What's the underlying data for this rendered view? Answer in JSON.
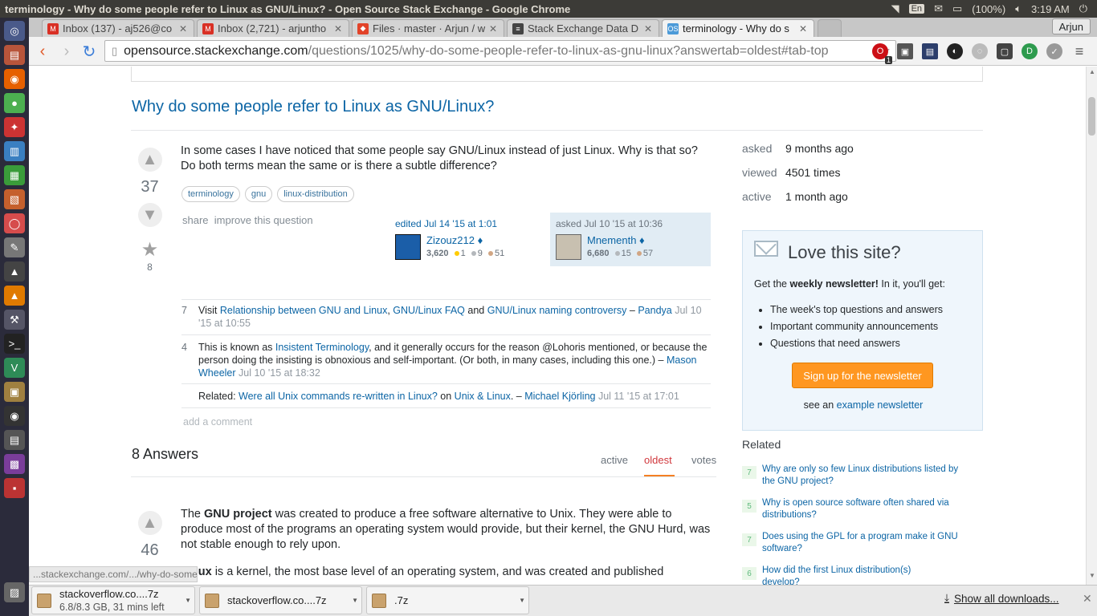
{
  "os": {
    "window_title": "terminology - Why do some people refer to Linux as GNU/Linux? - Open Source Stack Exchange - Google Chrome",
    "keyboard": "En",
    "battery": "(100%)",
    "clock": "3:19 AM"
  },
  "browser": {
    "tabs": [
      {
        "label": "Inbox (137) - aj526@co",
        "icon_color": "#d93025"
      },
      {
        "label": "Inbox (2,721) - arjuntho",
        "icon_color": "#d93025"
      },
      {
        "label": "Files · master · Arjun / w",
        "icon_color": "#e24329"
      },
      {
        "label": "Stack Exchange Data D",
        "icon_color": "#444444"
      },
      {
        "label": "terminology - Why do s",
        "icon_color": "#4c9ad8"
      }
    ],
    "user": "Arjun",
    "url_host": "opensource.stackexchange.com",
    "url_path": "/questions/1025/why-do-some-people-refer-to-linux-as-gnu-linux?answertab=oldest#tab-top",
    "opera_badge": "1"
  },
  "question": {
    "title": "Why do some people refer to Linux as GNU/Linux?",
    "votes": "37",
    "favorites": "8",
    "body": "In some cases I have noticed that some people say GNU/Linux instead of just Linux. Why is that so? Do both terms mean the same or is there a subtle difference?",
    "tags": [
      "terminology",
      "gnu",
      "linux-distribution"
    ],
    "share": "share",
    "improve": "improve this question",
    "edited": {
      "label": "edited Jul 14 '15 at 1:01",
      "user": "Zizouz212",
      "diamond": "♦",
      "rep": "3,620",
      "gold": "1",
      "silver": "9",
      "bronze": "51"
    },
    "asked": {
      "label": "asked Jul 10 '15 at 10:36",
      "user": "Mnementh",
      "diamond": "♦",
      "rep": "6,680",
      "silver": "15",
      "bronze": "57"
    },
    "comments": [
      {
        "score": "7",
        "pre": "Visit ",
        "link1": "Relationship between GNU and Linux",
        "sep1": ", ",
        "link2": "GNU/Linux FAQ",
        "sep2": " and ",
        "link3": "GNU/Linux naming controversy",
        "dash": " – ",
        "user": "Pandya",
        "time": "Jul 10 '15 at 10:55"
      },
      {
        "score": "4",
        "pre": "This is known as ",
        "link1": "Insistent Terminology",
        "text": ", and it generally occurs for the reason @Lohoris mentioned, or because the person doing the insisting is obnoxious and self-important. (Or both, in many cases, including this one.) – ",
        "user": "Mason Wheeler",
        "time": "Jul 10 '15 at 18:32"
      },
      {
        "score": "",
        "pre": "Related: ",
        "link1": "Were all Unix commands re-written in Linux?",
        "on": " on ",
        "link2": "Unix & Linux",
        "dash": ". – ",
        "user": "Michael Kjörling",
        "time": "Jul 11 '15 at 17:01"
      }
    ],
    "add_comment": "add a comment"
  },
  "answers": {
    "header": "8 Answers",
    "tabs": [
      "active",
      "oldest",
      "votes"
    ],
    "first": {
      "votes": "46",
      "p1_pre": "The ",
      "p1_bold": "GNU project",
      "p1_rest": " was created to produce a free software alternative to Unix. They were able to produce most of the programs an operating system would provide, but their kernel, the GNU Hurd, was not stable enough to rely upon.",
      "p2_bold": "Linux",
      "p2_rest": " is a kernel, the most base level of an operating system, and was created and published"
    }
  },
  "sidebar": {
    "asked_label": "asked",
    "asked_value": "9 months ago",
    "viewed_label": "viewed",
    "viewed_value": "4501 times",
    "active_label": "active",
    "active_value": "1 month ago",
    "newsletter": {
      "title": "Love this site?",
      "intro_pre": "Get the ",
      "intro_bold": "weekly newsletter!",
      "intro_post": " In it, you'll get:",
      "items": [
        "The week's top questions and answers",
        "Important community announcements",
        "Questions that need answers"
      ],
      "button": "Sign up for the newsletter",
      "see_pre": "see an ",
      "see_link": "example newsletter"
    },
    "related_title": "Related",
    "related": [
      {
        "score": "7",
        "text": "Why are only so few Linux distributions listed by the GNU project?"
      },
      {
        "score": "5",
        "text": "Why is open source software often shared via distributions?"
      },
      {
        "score": "7",
        "text": "Does using the GPL for a program make it GNU software?"
      },
      {
        "score": "6",
        "text": "How did the first Linux distribution(s) develop?"
      }
    ]
  },
  "status_url": "...stackexchange.com/.../why-do-some-people-refer-to-linux-as-gnu-linux",
  "downloads": {
    "items": [
      {
        "name": "stackoverflow.co....7z",
        "sub": "6.8/8.3 GB, 31 mins left"
      },
      {
        "name": "stackoverflow.co....7z",
        "sub": ""
      },
      {
        "name": ".7z",
        "sub": ""
      }
    ],
    "show_all": "Show all downloads...",
    "close": "✕"
  },
  "colors": {
    "link": "#0c65a5",
    "accent_selected_tab": "#d1383d",
    "newsletter_button": "#ff9720",
    "launcher_bg": "#2b2b3b"
  }
}
